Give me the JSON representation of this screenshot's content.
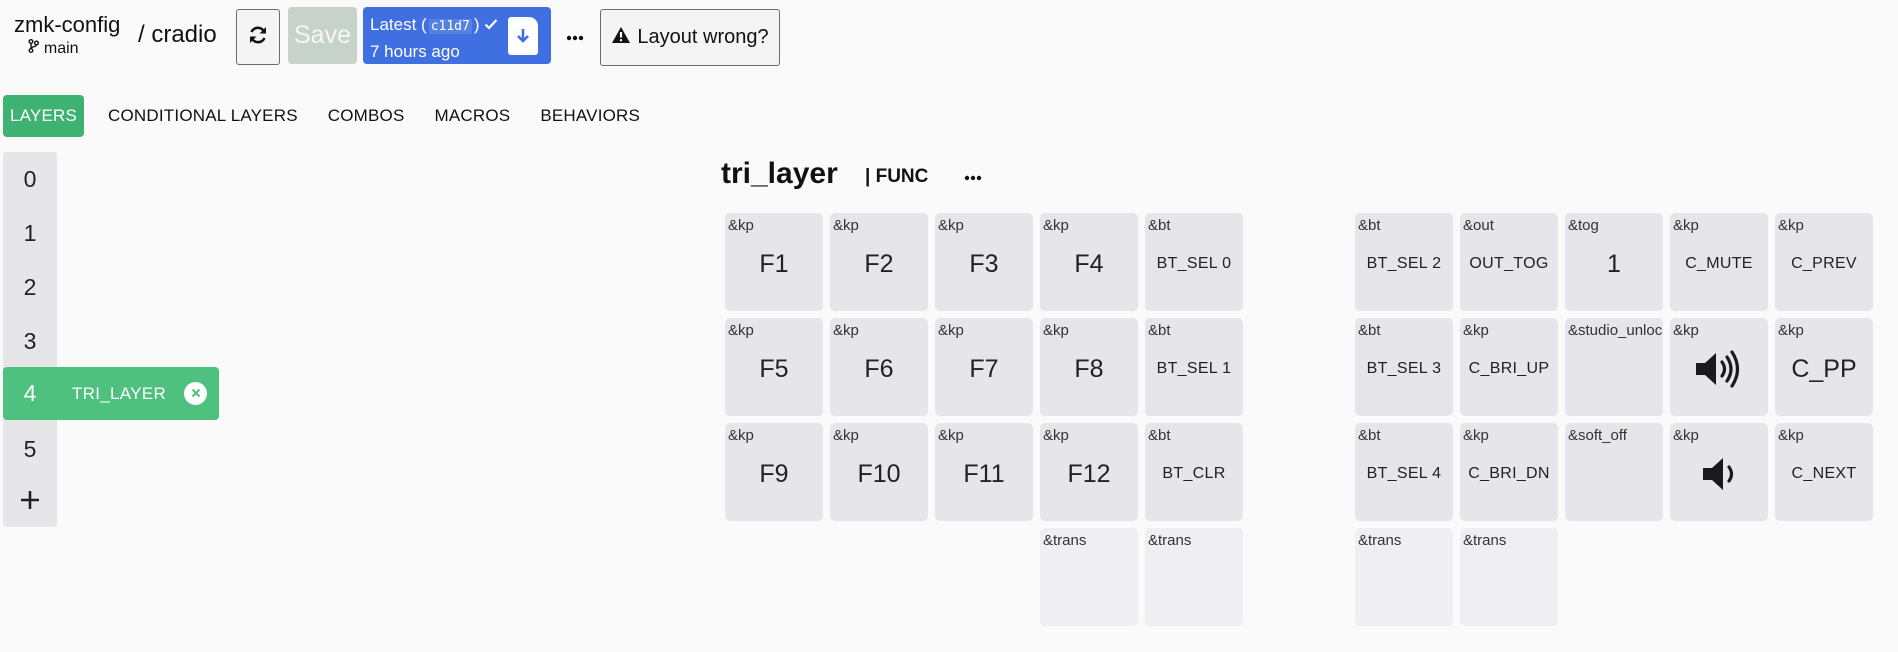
{
  "header": {
    "repo": "zmk-config",
    "branch": "main",
    "separator": "/",
    "keyboard": "cradio",
    "save_label": "Save",
    "latest_label": "Latest (",
    "commit_hash": "c11d7",
    "latest_close": ")",
    "latest_time": "7 hours ago",
    "layout_wrong_label": "Layout wrong?"
  },
  "tabs": [
    {
      "label": "LAYERS",
      "active": true
    },
    {
      "label": "CONDITIONAL LAYERS",
      "active": false
    },
    {
      "label": "COMBOS",
      "active": false
    },
    {
      "label": "MACROS",
      "active": false
    },
    {
      "label": "BEHAVIORS",
      "active": false
    }
  ],
  "layers": {
    "items": [
      "0",
      "1",
      "2",
      "3",
      "4",
      "5"
    ],
    "selected_index": 4,
    "selected_name": "TRI_LAYER"
  },
  "layer_view": {
    "name": "tri_layer",
    "display_name": "FUNC",
    "display_sep": "|"
  },
  "keys": [
    {
      "behavior": "&kp",
      "param": "F1",
      "size": "big"
    },
    {
      "behavior": "&kp",
      "param": "F2",
      "size": "big"
    },
    {
      "behavior": "&kp",
      "param": "F3",
      "size": "big"
    },
    {
      "behavior": "&kp",
      "param": "F4",
      "size": "big"
    },
    {
      "behavior": "&bt",
      "param": "BT_SEL 0",
      "size": "small"
    },
    {
      "behavior": "&bt",
      "param": "BT_SEL 2",
      "size": "small"
    },
    {
      "behavior": "&out",
      "param": "OUT_TOG",
      "size": "small"
    },
    {
      "behavior": "&tog",
      "param": "1",
      "size": "big"
    },
    {
      "behavior": "&kp",
      "param": "C_MUTE",
      "size": "small"
    },
    {
      "behavior": "&kp",
      "param": "C_PREV",
      "size": "small"
    },
    {
      "behavior": "&kp",
      "param": "F5",
      "size": "big"
    },
    {
      "behavior": "&kp",
      "param": "F6",
      "size": "big"
    },
    {
      "behavior": "&kp",
      "param": "F7",
      "size": "big"
    },
    {
      "behavior": "&kp",
      "param": "F8",
      "size": "big"
    },
    {
      "behavior": "&bt",
      "param": "BT_SEL 1",
      "size": "small"
    },
    {
      "behavior": "&bt",
      "param": "BT_SEL 3",
      "size": "small"
    },
    {
      "behavior": "&kp",
      "param": "C_BRI_UP",
      "size": "small"
    },
    {
      "behavior": "&studio_unlock",
      "param": "",
      "size": "small"
    },
    {
      "behavior": "&kp",
      "param": "",
      "icon": "volume-up-icon",
      "size": "icon"
    },
    {
      "behavior": "&kp",
      "param": "C_PP",
      "size": "big"
    },
    {
      "behavior": "&kp",
      "param": "F9",
      "size": "big"
    },
    {
      "behavior": "&kp",
      "param": "F10",
      "size": "big"
    },
    {
      "behavior": "&kp",
      "param": "F11",
      "size": "big"
    },
    {
      "behavior": "&kp",
      "param": "F12",
      "size": "big"
    },
    {
      "behavior": "&bt",
      "param": "BT_CLR",
      "size": "small"
    },
    {
      "behavior": "&bt",
      "param": "BT_SEL 4",
      "size": "small"
    },
    {
      "behavior": "&kp",
      "param": "C_BRI_DN",
      "size": "small"
    },
    {
      "behavior": "&soft_off",
      "param": "",
      "size": "small"
    },
    {
      "behavior": "&kp",
      "param": "",
      "icon": "volume-down-icon",
      "size": "icon"
    },
    {
      "behavior": "&kp",
      "param": "C_NEXT",
      "size": "small"
    },
    {
      "behavior": "&trans",
      "param": "",
      "size": "small"
    },
    {
      "behavior": "&trans",
      "param": "",
      "size": "small"
    },
    {
      "behavior": "&trans",
      "param": "",
      "size": "small"
    },
    {
      "behavior": "&trans",
      "param": "",
      "size": "small"
    }
  ],
  "colors": {
    "accent_green": "#3eb371",
    "selected_layer_green": "#4ec17e",
    "latest_blue": "#3f6fe0",
    "key_bg": "#e5e5ea"
  }
}
